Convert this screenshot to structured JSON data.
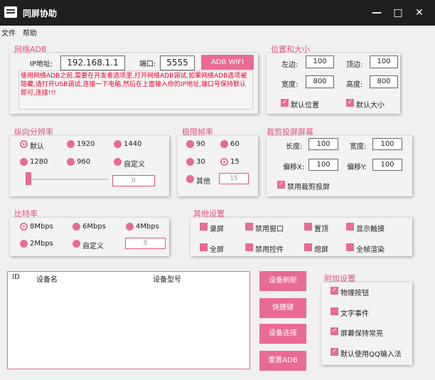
{
  "window": {
    "title": "同屏协助",
    "min": "—",
    "max": "□",
    "close": "✕"
  },
  "menu": {
    "file": "文件",
    "help": "帮助"
  },
  "adb": {
    "title": "网络ADB",
    "ip_label": "IP地址:",
    "ip_value": "192.168.1.1",
    "port_label": "端口:",
    "port_value": "5555",
    "wifi_button": "ADB WIFI",
    "notice": "使用网络ADB之前,需要在开发者选项里,打开网络ADB调试,如果网络ADB选项被隐藏,请打开USB调试,连接一下电脑,然后在上面输入你的IP地址,端口号保持默认即可,连接!!!"
  },
  "position": {
    "title": "位置和大小",
    "left_label": "左边:",
    "left_value": "100",
    "top_label": "顶边:",
    "top_value": "100",
    "width_label": "宽度:",
    "width_value": "800",
    "height_label": "高度:",
    "height_value": "800",
    "default_pos": "默认位置",
    "default_size": "默认大小"
  },
  "resolution": {
    "title": "纵向分辨率",
    "opt_default": "默认",
    "opt_1920": "1920",
    "opt_1440": "1440",
    "opt_1280": "1280",
    "opt_960": "960",
    "opt_custom": "自定义",
    "slider_value": "0",
    "slider_level": 0
  },
  "fps": {
    "title": "极限帧率",
    "opt_90": "90",
    "opt_60": "60",
    "opt_30": "30",
    "opt_15": "15",
    "opt_other": "其他",
    "other_value": "15"
  },
  "crop": {
    "title": "裁剪投屏屏幕",
    "len_label": "长度:",
    "len_value": "100",
    "width_label": "宽度:",
    "width_value": "100",
    "offx_label": "偏移X:",
    "offx_value": "100",
    "offy_label": "偏移Y:",
    "offy_value": "100",
    "disable": "禁用裁剪投屏"
  },
  "bitrate": {
    "title": "比特率",
    "opt_8": "8Mbps",
    "opt_6": "6Mbps",
    "opt_4": "4Mbps",
    "opt_2": "2Mbps",
    "opt_custom": "自定义",
    "custom_value": "8"
  },
  "other": {
    "title": "其他设置",
    "record": "录屏",
    "no_window": "禁用窗口",
    "on_top": "置顶",
    "show_touch": "显示触摸",
    "fullscreen": "全屏",
    "no_control": "禁用控件",
    "screen_off": "熄屏",
    "full_render": "全帧渲染"
  },
  "devices": {
    "col_id": "ID",
    "col_name": "设备名",
    "col_model": "设备型号"
  },
  "actions": {
    "refresh": "设备刷新",
    "shortcut": "快捷键",
    "connect": "设备连接",
    "reset": "重置ADB"
  },
  "extra": {
    "title": "附加设置",
    "physical": "物理按钮",
    "text_event": "文字事件",
    "stay_awake": "屏幕保持常亮",
    "qq_input": "默认使用QQ输入法"
  }
}
